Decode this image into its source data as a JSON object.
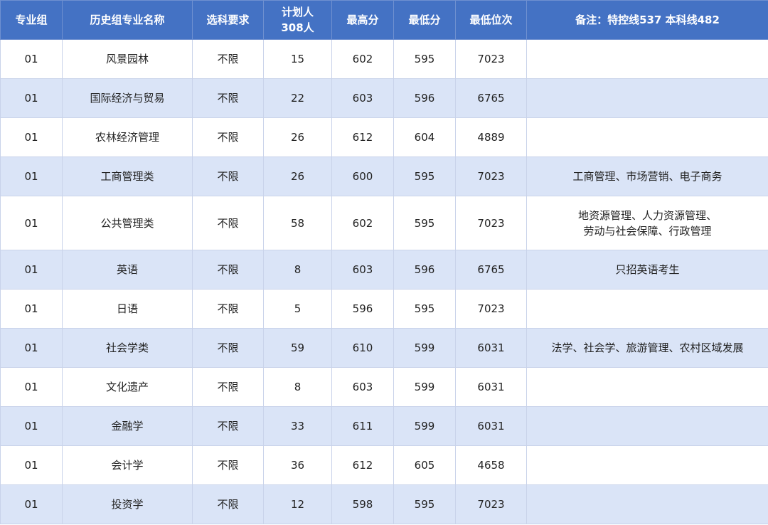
{
  "header": {
    "group": "专业组",
    "major": "历史组专业名称",
    "subject_req": "选科要求",
    "plan_line1": "计划人",
    "plan_line2": "308人",
    "max_score": "最高分",
    "min_score": "最低分",
    "min_rank": "最低位次",
    "notes": "备注：特控线537  本科线482"
  },
  "rows": [
    {
      "group": "01",
      "major": "风景园林",
      "req": "不限",
      "plan": "15",
      "max": "602",
      "min": "595",
      "rank": "7023",
      "note_l1": "",
      "note_l2": ""
    },
    {
      "group": "01",
      "major": "国际经济与贸易",
      "req": "不限",
      "plan": "22",
      "max": "603",
      "min": "596",
      "rank": "6765",
      "note_l1": "",
      "note_l2": ""
    },
    {
      "group": "01",
      "major": "农林经济管理",
      "req": "不限",
      "plan": "26",
      "max": "612",
      "min": "604",
      "rank": "4889",
      "note_l1": "",
      "note_l2": ""
    },
    {
      "group": "01",
      "major": "工商管理类",
      "req": "不限",
      "plan": "26",
      "max": "600",
      "min": "595",
      "rank": "7023",
      "note_l1": "工商管理、市场营销、电子商务",
      "note_l2": ""
    },
    {
      "group": "01",
      "major": "公共管理类",
      "req": "不限",
      "plan": "58",
      "max": "602",
      "min": "595",
      "rank": "7023",
      "note_l1": "地资源管理、人力资源管理、",
      "note_l2": "劳动与社会保障、行政管理"
    },
    {
      "group": "01",
      "major": "英语",
      "req": "不限",
      "plan": "8",
      "max": "603",
      "min": "596",
      "rank": "6765",
      "note_l1": "只招英语考生",
      "note_l2": ""
    },
    {
      "group": "01",
      "major": "日语",
      "req": "不限",
      "plan": "5",
      "max": "596",
      "min": "595",
      "rank": "7023",
      "note_l1": "",
      "note_l2": ""
    },
    {
      "group": "01",
      "major": "社会学类",
      "req": "不限",
      "plan": "59",
      "max": "610",
      "min": "599",
      "rank": "6031",
      "note_l1": "法学、社会学、旅游管理、农村区域发展",
      "note_l2": ""
    },
    {
      "group": "01",
      "major": "文化遗产",
      "req": "不限",
      "plan": "8",
      "max": "603",
      "min": "599",
      "rank": "6031",
      "note_l1": "",
      "note_l2": ""
    },
    {
      "group": "01",
      "major": "金融学",
      "req": "不限",
      "plan": "33",
      "max": "611",
      "min": "599",
      "rank": "6031",
      "note_l1": "",
      "note_l2": ""
    },
    {
      "group": "01",
      "major": "会计学",
      "req": "不限",
      "plan": "36",
      "max": "612",
      "min": "605",
      "rank": "4658",
      "note_l1": "",
      "note_l2": ""
    },
    {
      "group": "01",
      "major": "投资学",
      "req": "不限",
      "plan": "12",
      "max": "598",
      "min": "595",
      "rank": "7023",
      "note_l1": "",
      "note_l2": ""
    }
  ]
}
